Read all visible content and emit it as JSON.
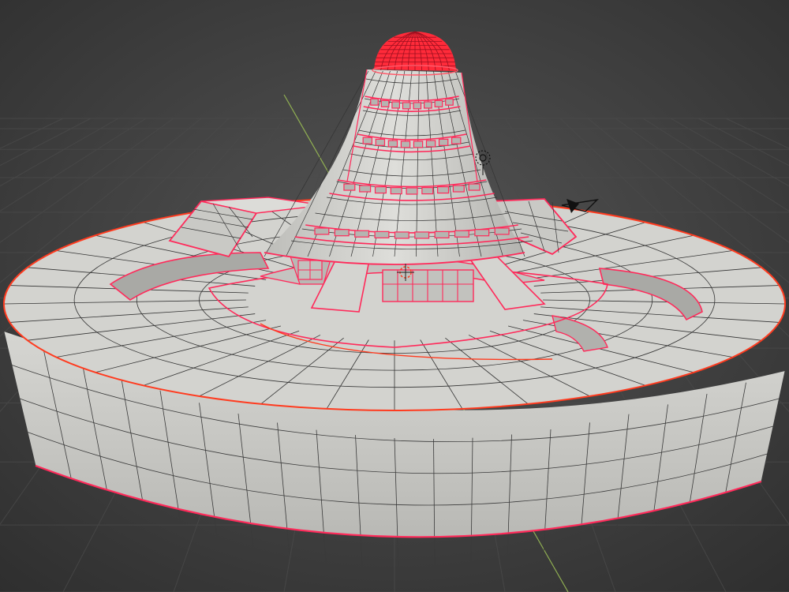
{
  "viewport": {
    "background": "#3d3d3d",
    "grid_color": "#4a4a4a",
    "axis_y_color": "#8fae52",
    "axis_x_color": "#a85a5a"
  },
  "mesh": {
    "fill": "#cfcfcc",
    "fill_shadow": "#aeaeab",
    "wire_color": "#2a2a2a",
    "edge_selected_color": "#ff2a5a",
    "edge_active_color": "#ff3b1f",
    "dome_color": "#ff2b3a"
  },
  "gizmos": {
    "light_icon": "light-icon",
    "camera_icon": "camera-icon",
    "cursor_icon": "3d-cursor-icon"
  }
}
